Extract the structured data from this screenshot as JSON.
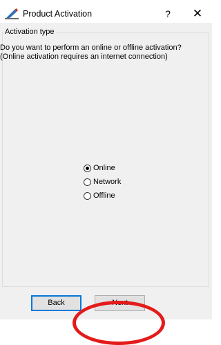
{
  "window": {
    "title": "Product Activation",
    "help_label": "?",
    "close_label": "✕",
    "icon": "product-activation-icon"
  },
  "group": {
    "label": "Activation type",
    "description_line1": "Do you want to perform an online or offline activation?",
    "description_line2": "(Online activation requires an internet connection)"
  },
  "options": [
    {
      "label": "Online",
      "checked": true
    },
    {
      "label": "Network",
      "checked": false
    },
    {
      "label": "Offline",
      "checked": false
    }
  ],
  "buttons": {
    "back_label": "Back",
    "next_label": "Next"
  },
  "colors": {
    "annotation": "#e41b1b",
    "focus_border": "#0078d7",
    "dialog_background": "#f0f0f0"
  }
}
